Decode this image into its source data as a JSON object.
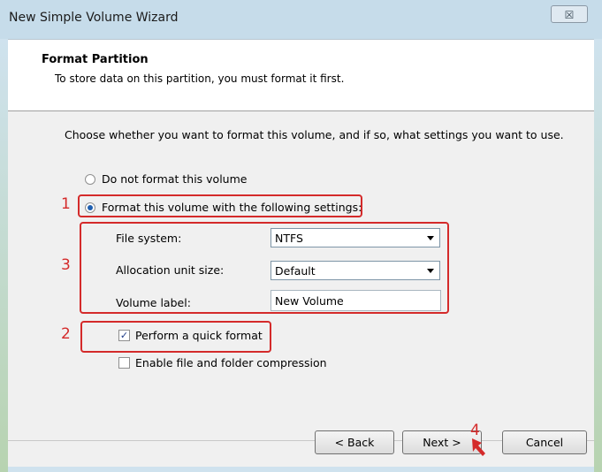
{
  "window": {
    "title": "New Simple Volume Wizard",
    "close_symbol": "☒"
  },
  "header": {
    "title": "Format Partition",
    "subtitle": "To store data on this partition, you must format it first."
  },
  "instruction": "Choose whether you want to format this volume, and if so, what settings you want to use.",
  "options": {
    "no_format_label": "Do not format this volume",
    "format_label": "Format this volume with the following settings:",
    "format_selected": true
  },
  "settings": {
    "file_system_label": "File system:",
    "file_system_value": "NTFS",
    "allocation_label": "Allocation unit size:",
    "allocation_value": "Default",
    "volume_label_label": "Volume label:",
    "volume_label_value": "New Volume"
  },
  "checkboxes": {
    "quick_format_label": "Perform a quick format",
    "quick_format_checked": true,
    "compression_label": "Enable file and folder compression",
    "compression_checked": false
  },
  "buttons": {
    "back": "< Back",
    "next": "Next >",
    "cancel": "Cancel"
  },
  "annotations": {
    "marker_1": "1",
    "marker_2": "2",
    "marker_3": "3",
    "marker_4": "4",
    "color": "#d42a2a"
  }
}
